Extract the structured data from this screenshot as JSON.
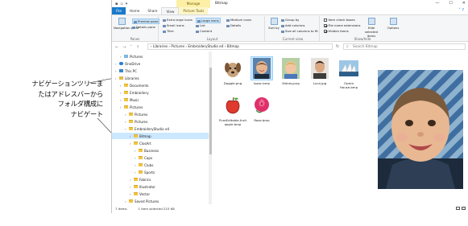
{
  "callout": {
    "lines": [
      "ナビゲーションツリーま",
      "たはアドレスバーから",
      "フォルダ構成に",
      "ナビゲート"
    ]
  },
  "window": {
    "title": "Bitmap",
    "context_tab_group": "Manage",
    "qat_icons": [
      "save-icon",
      "folder-icon",
      "dropdown-icon"
    ],
    "controls": [
      "—",
      "☐",
      "✕"
    ]
  },
  "tabs": [
    {
      "label": "File",
      "kind": "file"
    },
    {
      "label": "Home",
      "kind": "normal"
    },
    {
      "label": "Share",
      "kind": "normal"
    },
    {
      "label": "View",
      "kind": "active"
    },
    {
      "label": "Picture Tools",
      "kind": "ctx"
    }
  ],
  "ribbon": {
    "panes": {
      "group": "Panes",
      "navigation_pane": "Navigation pane",
      "preview_pane": "Preview pane",
      "details_pane": "Details pane"
    },
    "layout": {
      "group": "Layout",
      "items": [
        "Extra large icons",
        "Large icons",
        "Medium icons",
        "Small icons",
        "List",
        "Details",
        "Tiles",
        "Content"
      ]
    },
    "current_view": {
      "group": "Current view",
      "sort_by": "Sort by",
      "group_by": "Group by",
      "add_columns": "Add columns",
      "size_all_columns": "Size all columns to fit"
    },
    "show_hide": {
      "group": "Show/hide",
      "checks": [
        {
          "label": "Item check boxes",
          "checked": false
        },
        {
          "label": "File name extensions",
          "checked": true
        },
        {
          "label": "Hidden items",
          "checked": true
        }
      ],
      "hide_selected": "Hide selected items",
      "options": "Options"
    }
  },
  "address": {
    "path": "›  Libraries  ›  Pictures  ›  EmbroideryStudio e4  ›  Bitmap",
    "search_placeholder": "Search Bitmap"
  },
  "nav_tree": [
    {
      "label": "Pictures",
      "icon": "pictures-icon",
      "indent": 1
    },
    {
      "label": "OneDrive",
      "icon": "onedrive-icon",
      "indent": 0
    },
    {
      "label": "This PC",
      "icon": "pc-icon",
      "indent": 0
    },
    {
      "label": "Libraries",
      "icon": "library-icon",
      "indent": 0
    },
    {
      "label": "Documents",
      "icon": "folder-icon",
      "indent": 1
    },
    {
      "label": "Embroidery",
      "icon": "folder-icon",
      "indent": 1
    },
    {
      "label": "Music",
      "icon": "folder-icon",
      "indent": 1
    },
    {
      "label": "Pictures",
      "icon": "folder-icon",
      "indent": 1
    },
    {
      "label": "Pictures",
      "icon": "folder-icon",
      "indent": 2
    },
    {
      "label": "Pictures",
      "icon": "folder-icon",
      "indent": 2
    },
    {
      "label": "EmbroideryStudio e4",
      "icon": "folder-icon",
      "indent": 2
    },
    {
      "label": "Bitmap",
      "icon": "folder-icon",
      "indent": 3,
      "selected": true
    },
    {
      "label": "ClosArt",
      "icon": "folder-icon",
      "indent": 3
    },
    {
      "label": "Business",
      "icon": "folder-icon",
      "indent": 4
    },
    {
      "label": "Caps",
      "icon": "folder-icon",
      "indent": 4
    },
    {
      "label": "Clubs",
      "icon": "folder-icon",
      "indent": 4
    },
    {
      "label": "Sports",
      "icon": "folder-icon",
      "indent": 4
    },
    {
      "label": "Fabrics",
      "icon": "folder-icon",
      "indent": 3
    },
    {
      "label": "Illustrator",
      "icon": "folder-icon",
      "indent": 3
    },
    {
      "label": "Vector",
      "icon": "folder-icon",
      "indent": 3
    },
    {
      "label": "Saved Pictures",
      "icon": "folder-icon",
      "indent": 2
    }
  ],
  "files": [
    {
      "name": "Doggie.png",
      "thumb": "dog-thumb",
      "selected": false
    },
    {
      "name": "Isaac.bmp",
      "thumb": "baby-thumb",
      "selected": true
    },
    {
      "name": "Kidney.png",
      "thumb": "kid-thumb",
      "selected": false
    },
    {
      "name": "Luca.jpg",
      "thumb": "man-thumb",
      "selected": false
    },
    {
      "name": "Opera House.bmp",
      "thumb": "opera-thumb",
      "selected": false
    },
    {
      "name": "PureEditable-fruit apple.bmp",
      "thumb": "apple-thumb",
      "selected": false
    },
    {
      "name": "Rose.bmp",
      "thumb": "rose-thumb",
      "selected": false
    }
  ],
  "status": {
    "items": "7 items",
    "selected": "1 item selected  223 KB"
  },
  "colors": {
    "accent": "#1979ca",
    "selection": "#cce8ff",
    "context_tab": "#fdf0a6"
  }
}
